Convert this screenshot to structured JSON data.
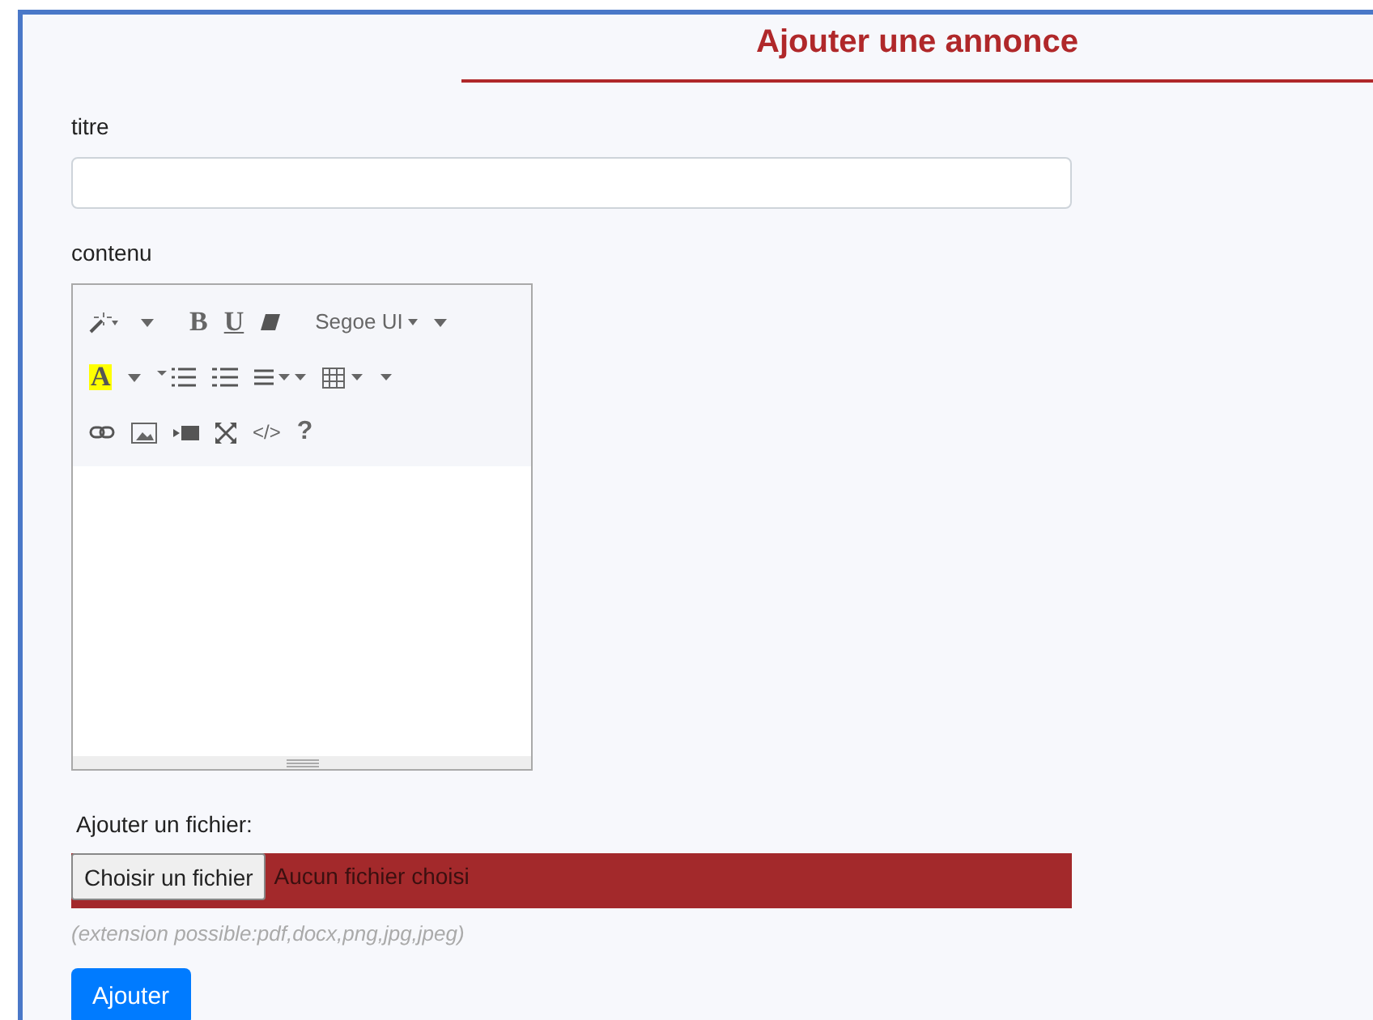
{
  "title": "Ajouter une annonce",
  "fields": {
    "titre_label": "titre",
    "contenu_label": "contenu"
  },
  "editor": {
    "bold": "B",
    "underline": "U",
    "font": "Segoe UI",
    "text_color": "A",
    "code": "</>",
    "help": "?"
  },
  "file": {
    "label": "Ajouter un fichier:",
    "button": "Choisir un fichier",
    "status": "Aucun fichier choisi",
    "hint": "(extension possible:pdf,docx,png,jpg,jpeg)"
  },
  "submit": "Ajouter"
}
